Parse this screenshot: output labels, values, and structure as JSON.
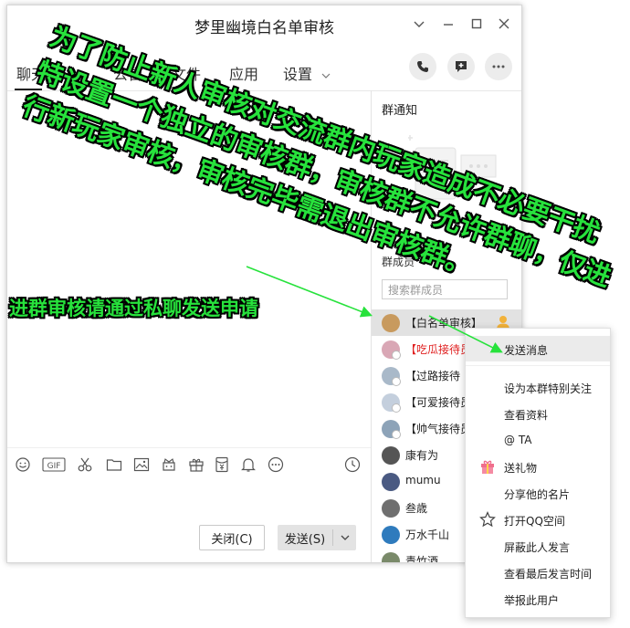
{
  "window": {
    "title": "梦里幽境白名单审核",
    "controls": [
      "chevron-down-icon",
      "minimize-icon",
      "maximize-icon",
      "close-icon"
    ]
  },
  "tabs": [
    {
      "label": "聊天",
      "active": true
    },
    {
      "label": "公告",
      "active": false
    },
    {
      "label": "文件",
      "active": false
    },
    {
      "label": "应用",
      "active": false
    },
    {
      "label": "设置",
      "active": false
    }
  ],
  "header_actions": [
    "phone-icon",
    "add-message-icon",
    "more-icon"
  ],
  "toolbar": {
    "icons": [
      "emoji-icon",
      "gif-icon",
      "scissors-icon",
      "folder-icon",
      "image-icon",
      "gift-box-icon",
      "present-icon",
      "red-packet-icon",
      "bell-icon",
      "more-circle-icon"
    ],
    "history_icon": "clock-icon",
    "gif_label": "GIF"
  },
  "footer": {
    "close_label": "关闭(C)",
    "send_label": "发送(S)"
  },
  "right_panel": {
    "notice_title": "群通知",
    "members_label": "群成员",
    "search_placeholder": "搜索群成员"
  },
  "members": [
    {
      "name": "【白名单审核】",
      "selected": true,
      "red": false,
      "owner": true
    },
    {
      "name": "【吃瓜接待员",
      "selected": false,
      "red": true,
      "owner": false
    },
    {
      "name": "【过路接待",
      "selected": false,
      "red": false,
      "owner": false
    },
    {
      "name": "【可爱接待员",
      "selected": false,
      "red": false,
      "owner": false
    },
    {
      "name": "【帅气接待员",
      "selected": false,
      "red": false,
      "owner": false
    },
    {
      "name": "康有为",
      "selected": false,
      "red": false,
      "owner": false
    },
    {
      "name": "mumu",
      "selected": false,
      "red": false,
      "owner": false
    },
    {
      "name": "叁歳",
      "selected": false,
      "red": false,
      "owner": false
    },
    {
      "name": "万水千山",
      "selected": false,
      "red": false,
      "owner": false
    },
    {
      "name": "青竹酒",
      "selected": false,
      "red": false,
      "owner": false
    }
  ],
  "context_menu": [
    {
      "label": "发送消息",
      "icon": "",
      "highlighted": true
    },
    {
      "label": "设为本群特别关注",
      "icon": "",
      "highlighted": false
    },
    {
      "label": "查看资料",
      "icon": "",
      "highlighted": false
    },
    {
      "label": "@ TA",
      "icon": "",
      "highlighted": false
    },
    {
      "label": "送礼物",
      "icon": "gift-icon",
      "highlighted": false
    },
    {
      "label": "分享他的名片",
      "icon": "",
      "highlighted": false
    },
    {
      "label": "打开QQ空间",
      "icon": "star-icon",
      "highlighted": false
    },
    {
      "label": "屏蔽此人发言",
      "icon": "",
      "highlighted": false
    },
    {
      "label": "查看最后发言时间",
      "icon": "",
      "highlighted": false
    },
    {
      "label": "举报此用户",
      "icon": "",
      "highlighted": false
    }
  ],
  "annotations": {
    "line1": "为了防止新人审核对交流群内玩家造成不必要干扰",
    "line2": "特设置一个独立的审核群，审核群不允许群聊，仅进",
    "line3": "行新玩家审核，审核完毕需退出审核群。",
    "hint": "进群审核请通过私聊发送申请",
    "color": "#27e23c"
  }
}
